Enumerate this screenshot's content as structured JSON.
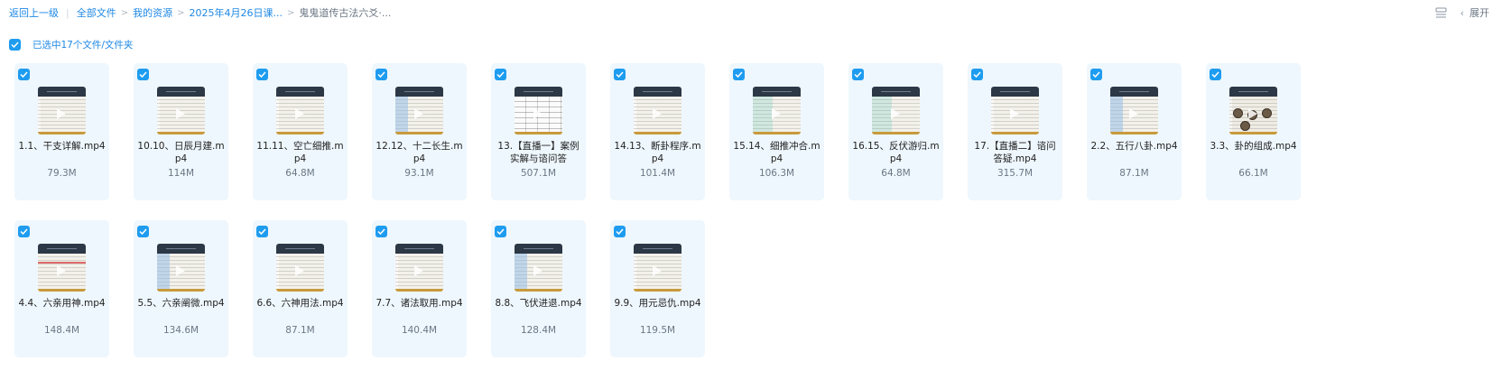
{
  "breadcrumb": {
    "back": "返回上一级",
    "items": [
      "全部文件",
      "我的资源",
      "2025年4月26日课...",
      "鬼鬼道传古法六爻·..."
    ]
  },
  "toolbar": {
    "expand_label": "展开",
    "collapse_icon": "chevron-left-icon",
    "list_icon": "list-view-icon"
  },
  "selection": {
    "text": "已选中17个文件/文件夹",
    "checked": true
  },
  "colors": {
    "accent": "#1e88e5",
    "checkbox": "#1e9cf0",
    "tile_bg": "#eef7fd"
  },
  "files": [
    {
      "name": "1.1、干支详解.mp4",
      "size": "79.3M",
      "variant": "plain"
    },
    {
      "name": "10.10、日辰月建.mp4",
      "size": "114M",
      "variant": "plain"
    },
    {
      "name": "11.11、空亡细推.mp4",
      "size": "64.8M",
      "variant": "plain"
    },
    {
      "name": "12.12、十二长生.mp4",
      "size": "93.1M",
      "variant": "blue"
    },
    {
      "name": "13.【直播一】案例实解与谘问答",
      "size": "507.1M",
      "variant": "table"
    },
    {
      "name": "14.13、断卦程序.mp4",
      "size": "101.4M",
      "variant": "plain"
    },
    {
      "name": "15.14、细推冲合.mp4",
      "size": "106.3M",
      "variant": "green"
    },
    {
      "name": "16.15、反伏游归.mp4",
      "size": "64.8M",
      "variant": "green"
    },
    {
      "name": "17.【直播二】谘问答疑.mp4",
      "size": "315.7M",
      "variant": "plain"
    },
    {
      "name": "2.2、五行八卦.mp4",
      "size": "87.1M",
      "variant": "blue"
    },
    {
      "name": "3.3、卦的组成.mp4",
      "size": "66.1M",
      "variant": "coins"
    },
    {
      "name": "4.4、六亲用神.mp4",
      "size": "148.4M",
      "variant": "red"
    },
    {
      "name": "5.5、六亲阐微.mp4",
      "size": "134.6M",
      "variant": "blue"
    },
    {
      "name": "6.6、六神用法.mp4",
      "size": "87.1M",
      "variant": "plain"
    },
    {
      "name": "7.7、诸法取用.mp4",
      "size": "140.4M",
      "variant": "plain"
    },
    {
      "name": "8.8、飞伏进退.mp4",
      "size": "128.4M",
      "variant": "blue"
    },
    {
      "name": "9.9、用元忌仇.mp4",
      "size": "119.5M",
      "variant": "plain"
    }
  ]
}
